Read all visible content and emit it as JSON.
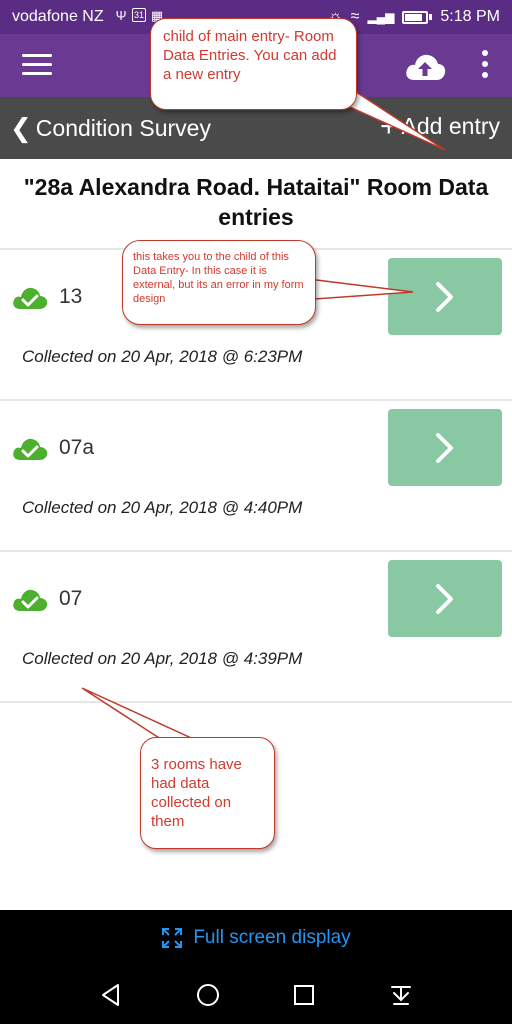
{
  "status_bar": {
    "carrier": "vodafone NZ",
    "time": "5:18 PM",
    "calendar_day": "31"
  },
  "app_bar": {
    "menu_icon": "hamburger-menu-icon",
    "upload_icon": "cloud-upload-icon",
    "overflow_icon": "more-vertical-icon"
  },
  "sub_header": {
    "back_label": "Condition Survey",
    "add_label": "Add entry"
  },
  "page": {
    "title": "\"28a Alexandra Road. Hataitai\" Room Data entries"
  },
  "entries": [
    {
      "name": "13",
      "collected": "Collected on 20 Apr, 2018 @ 6:23PM",
      "synced": true
    },
    {
      "name": "07a",
      "collected": "Collected on 20 Apr, 2018 @ 4:40PM",
      "synced": true
    },
    {
      "name": "07",
      "collected": "Collected on 20 Apr, 2018 @ 4:39PM",
      "synced": true
    }
  ],
  "callouts": {
    "top": "child of main entry- Room Data Entries. You can add a new entry",
    "middle": "this takes you to the child of this Data Entry- In this case it is external, but its an error in my form design",
    "bottom": "3 rooms have had data collected on them"
  },
  "footer": {
    "fullscreen_label": "Full screen display"
  },
  "colors": {
    "status_bar": "#5b2c83",
    "app_bar": "#6a3a93",
    "sub_header": "#4a4a4a",
    "go_button": "#88c9a3",
    "synced_icon": "#4caf2e",
    "callout_text": "#d03a30",
    "fullscreen_text": "#2196f3"
  }
}
